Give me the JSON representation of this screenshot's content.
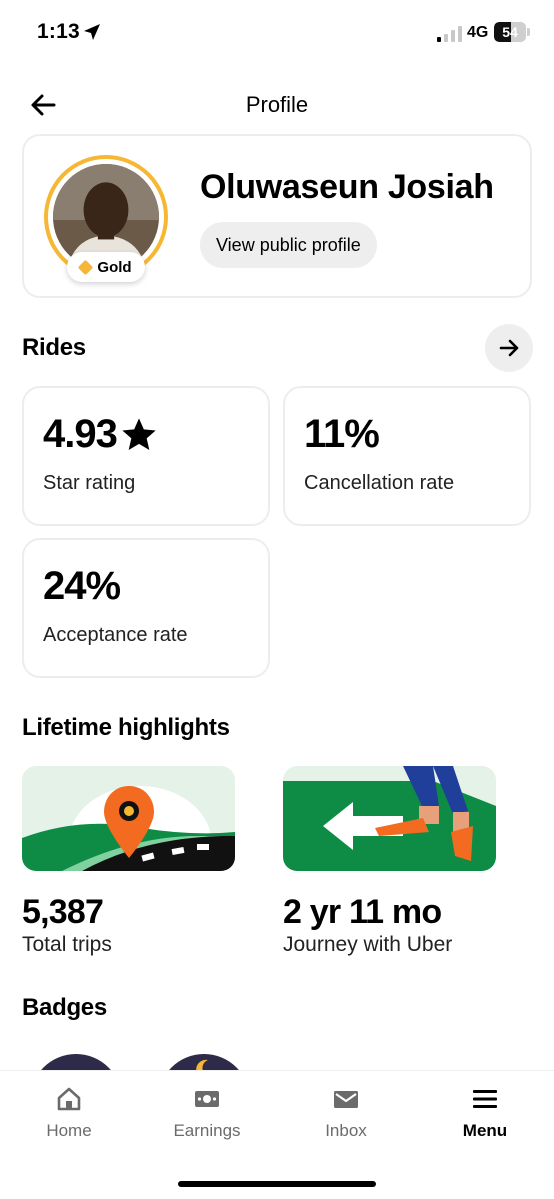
{
  "status_bar": {
    "time": "1:13",
    "network": "4G",
    "battery": "54",
    "battery_level": 0.54
  },
  "header": {
    "title": "Profile"
  },
  "profile": {
    "name": "Oluwaseun Josiah",
    "tier": "Gold",
    "view_profile_label": "View public profile",
    "tier_color": "#f6b834"
  },
  "rides": {
    "title": "Rides",
    "stats": [
      {
        "value": "4.93",
        "label": "Star rating"
      },
      {
        "value": "11%",
        "label": "Cancellation rate"
      },
      {
        "value": "24%",
        "label": "Acceptance rate"
      }
    ]
  },
  "highlights": {
    "title": "Lifetime highlights",
    "items": [
      {
        "value": "5,387",
        "label": "Total trips",
        "icon": "map-pin-road-illustration"
      },
      {
        "value": "2 yr 11 mo",
        "label": "Journey with Uber",
        "icon": "walking-arrow-illustration"
      }
    ]
  },
  "badges": {
    "title": "Badges"
  },
  "bottom_nav": {
    "items": [
      {
        "label": "Home",
        "icon": "home-icon"
      },
      {
        "label": "Earnings",
        "icon": "earnings-icon"
      },
      {
        "label": "Inbox",
        "icon": "inbox-icon"
      },
      {
        "label": "Menu",
        "icon": "menu-icon",
        "active": true
      }
    ]
  },
  "colors": {
    "accent_green": "#0e8c45",
    "gold": "#f6b834",
    "pin_orange": "#f26b21"
  }
}
